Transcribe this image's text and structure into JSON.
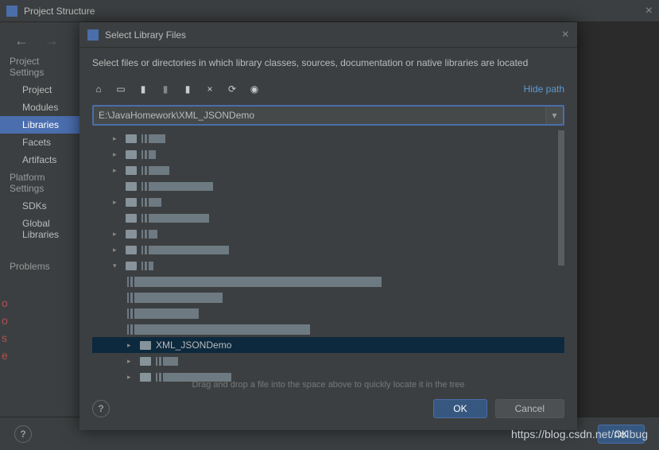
{
  "window": {
    "title": "Project Structure"
  },
  "sidebar": {
    "section1": "Project Settings",
    "items1": [
      "Project",
      "Modules",
      "Libraries",
      "Facets",
      "Artifacts"
    ],
    "section2": "Platform Settings",
    "items2": [
      "SDKs",
      "Global Libraries"
    ],
    "section3": "Problems"
  },
  "dialog": {
    "title": "Select Library Files",
    "desc": "Select files or directories in which library classes, sources, documentation or native libraries are located",
    "hidePath": "Hide path",
    "path": "E:\\JavaHomework\\XML_JSONDemo",
    "selected": "XML_JSONDemo",
    "dragHint": "Drag and drop a file into the space above to quickly locate it in the tree",
    "ok": "OK",
    "cancel": "Cancel"
  },
  "bottom": {
    "ok": "OK"
  },
  "watermark": "https://blog.csdn.net/noIbug"
}
